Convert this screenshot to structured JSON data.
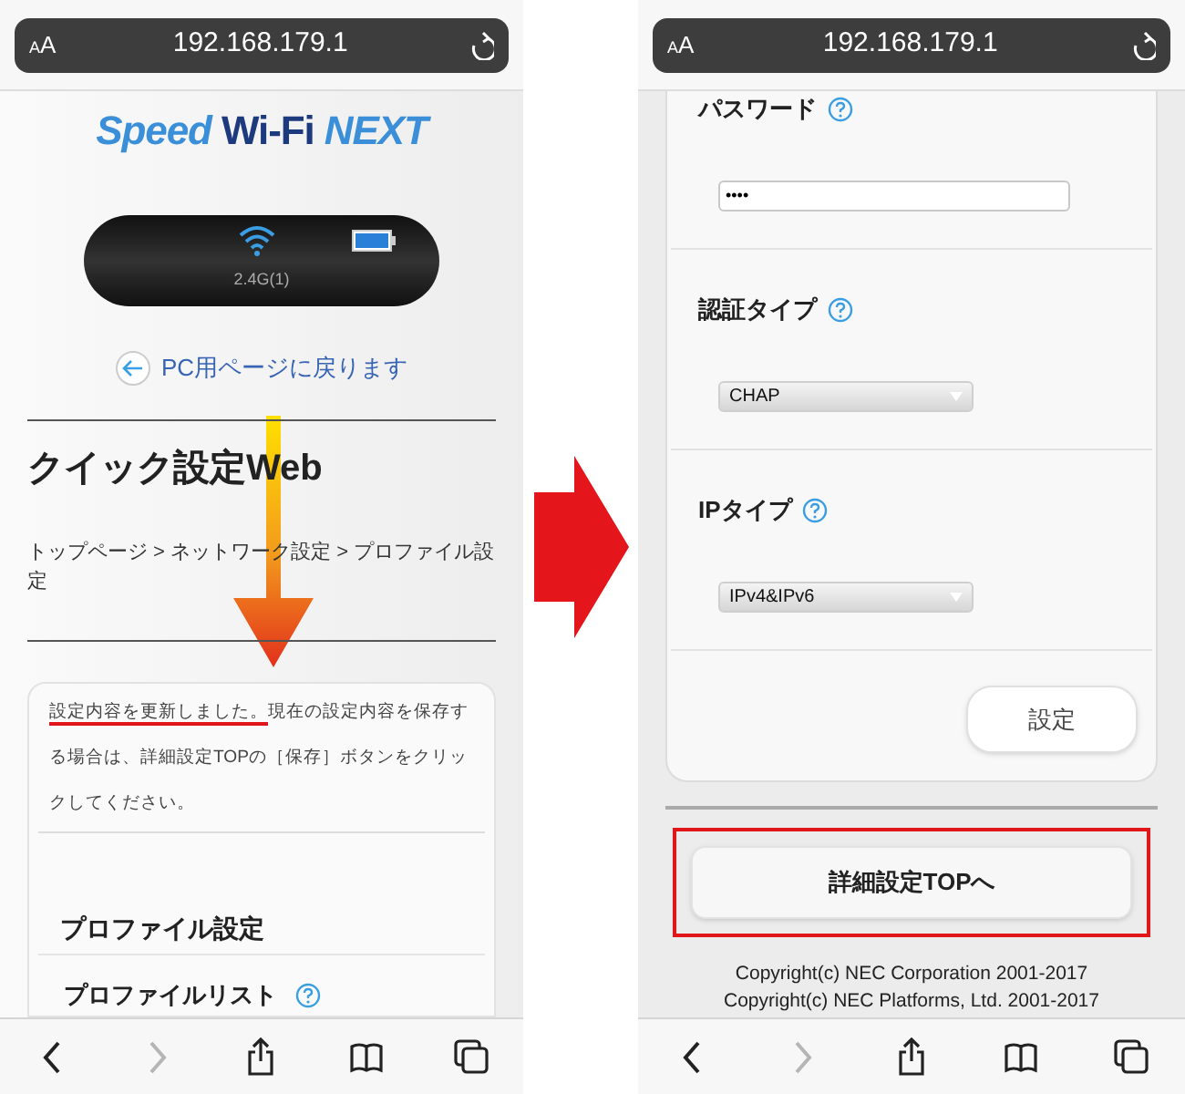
{
  "left_phone": {
    "address_bar": {
      "text_size": "AA",
      "url": "192.168.179.1"
    },
    "logo": [
      "Speed",
      "Wi-Fi",
      "NEXT"
    ],
    "device_status": {
      "band": "2.4G(1)"
    },
    "back_link": "PC用ページに戻ります",
    "title": "クイック設定Web",
    "breadcrumb": "トップページ > ネットワーク設定 > プロファイル設定",
    "message": {
      "underlined": "設定内容を更新しました。",
      "rest": "現在の設定内容を保存する場合は、詳細設定TOPの［保存］ボタンをクリックしてください。"
    },
    "section_title": "プロファイル設定",
    "field_label": "プロファイルリスト",
    "toolbar": [
      {
        "kind": "back",
        "disabled": false
      },
      {
        "kind": "forward",
        "disabled": true
      },
      {
        "kind": "share",
        "disabled": false
      },
      {
        "kind": "bookmarks",
        "disabled": false
      },
      {
        "kind": "tabs",
        "disabled": false
      }
    ]
  },
  "right_phone": {
    "address_bar": {
      "text_size": "AA",
      "url": "192.168.179.1"
    },
    "fields": [
      {
        "label": "パスワード",
        "kind": "password",
        "value": "••••"
      },
      {
        "label": "認証タイプ",
        "kind": "select",
        "value": "CHAP"
      },
      {
        "label": "IPタイプ",
        "kind": "select",
        "value": "IPv4&IPv6"
      }
    ],
    "submit_button": "設定",
    "top_button": {
      "label": "詳細設定TOPへ",
      "highlighted": true
    },
    "copyright": [
      "Copyright(c) NEC Corporation 2001-2017",
      "Copyright(c) NEC Platforms, Ltd. 2001-2017"
    ],
    "toolbar": [
      {
        "kind": "back",
        "disabled": false
      },
      {
        "kind": "forward",
        "disabled": true
      },
      {
        "kind": "share",
        "disabled": false
      },
      {
        "kind": "bookmarks",
        "disabled": false
      },
      {
        "kind": "tabs",
        "disabled": false
      }
    ]
  }
}
